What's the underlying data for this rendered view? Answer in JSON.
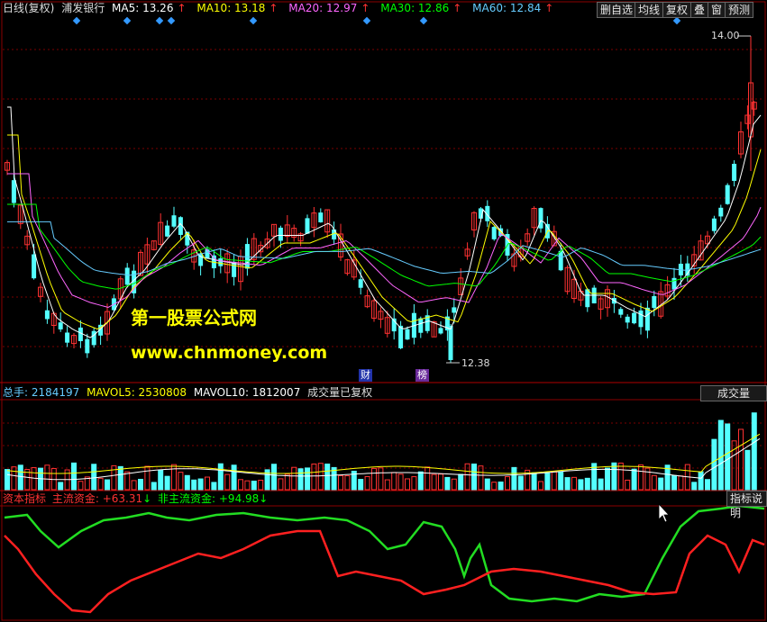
{
  "header": {
    "period": "日线(复权)",
    "stock_name": "浦发银行",
    "ma": [
      {
        "label": "MA5: 13.26",
        "color": "#ffffff"
      },
      {
        "label": "MA10: 13.18",
        "color": "#ffff00"
      },
      {
        "label": "MA20: 12.97",
        "color": "#ff66ff"
      },
      {
        "label": "MA30: 12.86",
        "color": "#00ff00"
      },
      {
        "label": "MA60: 12.84",
        "color": "#66ccff"
      }
    ],
    "up_arrow": "↑",
    "buttons": [
      "删自选",
      "均线",
      "复权",
      "叠",
      "窗",
      "预测"
    ]
  },
  "price_chart": {
    "high_label": "14.00",
    "low_label": "12.38",
    "event_tags": [
      "财",
      "榜"
    ],
    "watermark_title": "第一股票公式网",
    "watermark_url": "www.chnmoney.com"
  },
  "volume_panel": {
    "total_label": "总手: 2184197",
    "mavol5": "MAVOL5: 2530808",
    "mavol10": "MAVOL10: 1812007",
    "note": "成交量已复权",
    "tab": "成交量"
  },
  "indicator_panel": {
    "name": "资本指标",
    "main_label": "主流资金: +63.31",
    "main_arrow": "↓",
    "nonmain_label": "非主流资金: +94.98",
    "nonmain_arrow": "↓",
    "button": "指标说明"
  },
  "colors": {
    "up": "#ff3232",
    "down": "#54ffff",
    "main_fund": "#ff2020",
    "nonmain_fund": "#22dd22",
    "grid": "#7a0000",
    "marker": "#3399ff"
  }
}
